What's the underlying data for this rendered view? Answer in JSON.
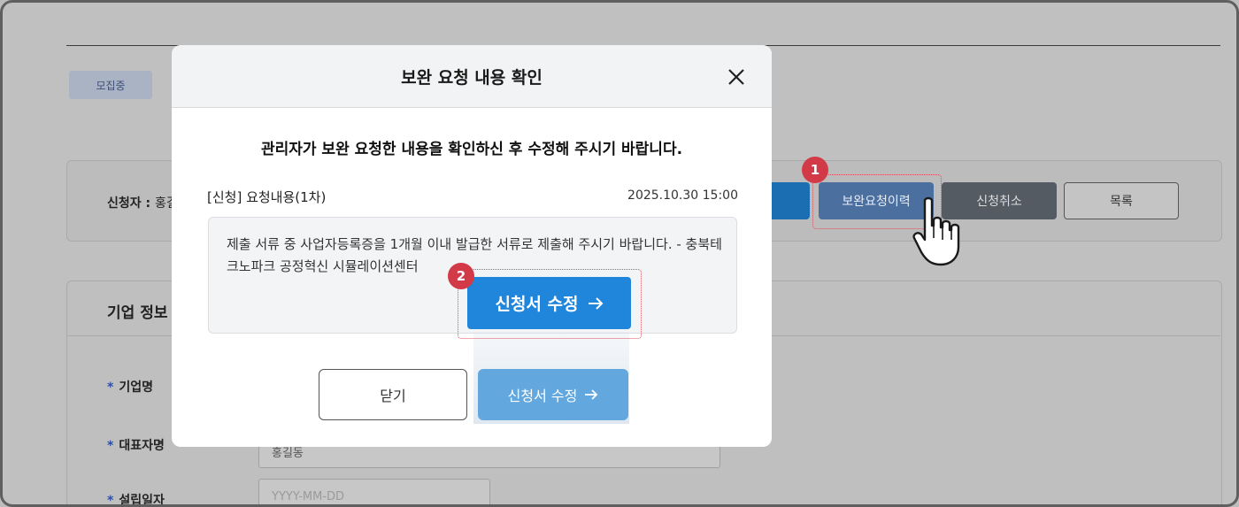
{
  "background": {
    "status_badge": "모집중",
    "applicant_label": "신청자 :",
    "applicant_name": "홍길",
    "buttons": {
      "revision_history": "보완요청이력",
      "cancel_application": "신청취소",
      "list": "목록"
    },
    "section_title": "기업 정보",
    "fields": [
      {
        "label": "기업명",
        "required": "*"
      },
      {
        "label": "대표자명",
        "required": "*",
        "value": "홍길동"
      },
      {
        "label": "설립일자",
        "required": "*",
        "placeholder": "YYYY-MM-DD"
      }
    ]
  },
  "modal": {
    "title": "보완 요청 내용 확인",
    "instruction": "관리자가 보완 요청한 내용을 확인하신 후 수정해 주시기 바랍니다.",
    "request_label": "[신청] 요청내용(1차)",
    "request_datetime": "2025.10.30 15:00",
    "request_text": "제출 서류 중 사업자등록증을 1개월 이내 발급한 서류로 제출해 주시기 바랍니다. - 충북테크노파크 공정혁신 시뮬레이션센터",
    "callout_button_label": "신청서 수정",
    "close_button": "닫기",
    "edit_button": "신청서 수정"
  },
  "annotations": {
    "step1": "1",
    "step2": "2",
    "highlight_color": "#e64a56"
  },
  "icons": {
    "close": "close-icon",
    "arrow": "arrow-right-icon",
    "pointer": "hand-pointer-icon"
  }
}
